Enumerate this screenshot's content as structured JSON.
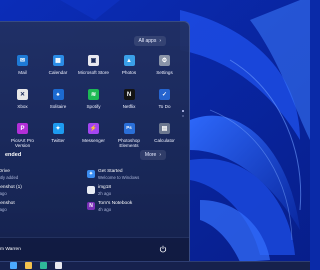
{
  "start_menu": {
    "all_apps_label": "All apps",
    "pinned": [
      {
        "label": "Mail",
        "icon": "mail-icon",
        "color": "#1e7ad6",
        "glyph": "✉"
      },
      {
        "label": "Calendar",
        "icon": "calendar-icon",
        "color": "#2a8ce6",
        "glyph": "▦"
      },
      {
        "label": "Microsoft Store",
        "icon": "store-icon",
        "color": "#e8e8f0",
        "glyph": "▣"
      },
      {
        "label": "Photos",
        "icon": "photos-icon",
        "color": "#3aa0e8",
        "glyph": "▲"
      },
      {
        "label": "Settings",
        "icon": "gear-icon",
        "color": "#8a94a8",
        "glyph": "⚙"
      },
      {
        "label": "Xbox",
        "icon": "xbox-icon",
        "color": "#e8e8e8",
        "glyph": "✕"
      },
      {
        "label": "Solitaire",
        "icon": "solitaire-icon",
        "color": "#1c6ad0",
        "glyph": "♠"
      },
      {
        "label": "Spotify",
        "icon": "spotify-icon",
        "color": "#1db954",
        "glyph": "≋"
      },
      {
        "label": "Netflix",
        "icon": "netflix-icon",
        "color": "#141414",
        "glyph": "N"
      },
      {
        "label": "To Do",
        "icon": "todo-icon",
        "color": "#2564cf",
        "glyph": "✓"
      },
      {
        "label": "PicsArt Pro Version",
        "icon": "picsart-icon",
        "color": "#b22fd8",
        "glyph": "P"
      },
      {
        "label": "Twitter",
        "icon": "twitter-icon",
        "color": "#1d9bf0",
        "glyph": "✦"
      },
      {
        "label": "Messenger",
        "icon": "messenger-icon",
        "color": "#a445f0",
        "glyph": "⚡"
      },
      {
        "label": "Photoshop Elements",
        "icon": "photoshop-icon",
        "color": "#2a6fd8",
        "glyph": "Ps"
      },
      {
        "label": "Calculator",
        "icon": "calculator-icon",
        "color": "#6c7890",
        "glyph": "▤"
      }
    ],
    "recommended_title": "ended",
    "more_label": "More",
    "recommended": [
      {
        "name": "eDrive",
        "sub": "ently added",
        "icon": "onedrive-icon",
        "color": "#2b7bd6",
        "col": "left",
        "glyph": ""
      },
      {
        "name": "Get Started",
        "sub": "Welcome to Windows",
        "icon": "get-started-icon",
        "color": "#3a8cf0",
        "col": "right",
        "glyph": "✦"
      },
      {
        "name": "reenshot (1)",
        "sub": "n ago",
        "icon": "screenshot-icon",
        "color": "#5a7ac8",
        "col": "left",
        "glyph": ""
      },
      {
        "name": "img18",
        "sub": "2h ago",
        "icon": "image-file-icon",
        "color": "#e8ecf4",
        "col": "right",
        "glyph": ""
      },
      {
        "name": "reenshot",
        "sub": "n ago",
        "icon": "screenshot-icon",
        "color": "#5a7ac8",
        "col": "left",
        "glyph": ""
      },
      {
        "name": "Tom's Notebook",
        "sub": "4h ago",
        "icon": "onenote-icon",
        "color": "#7a2fb8",
        "col": "right",
        "glyph": "N"
      }
    ],
    "user_name": "m Warren"
  },
  "taskbar": {
    "icons": [
      {
        "icon": "start-icon",
        "color": "#4aa8ff"
      },
      {
        "icon": "explorer-icon",
        "color": "#f2c14e"
      },
      {
        "icon": "edge-icon",
        "color": "#2fb89a"
      },
      {
        "icon": "store-icon",
        "color": "#e8e8f0"
      }
    ]
  }
}
